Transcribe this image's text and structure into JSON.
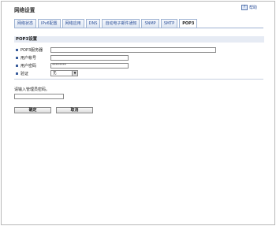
{
  "page": {
    "title": "网络设置"
  },
  "help": {
    "label": "帮助",
    "icon": "help-book-icon"
  },
  "tabs": [
    {
      "label": "网络状态",
      "active": false
    },
    {
      "label": "IPv6配置",
      "active": false
    },
    {
      "label": "网络应用",
      "active": false
    },
    {
      "label": "DNS",
      "active": false
    },
    {
      "label": "自动电子邮件通知",
      "active": false
    },
    {
      "label": "SNMP",
      "active": false
    },
    {
      "label": "SMTP",
      "active": false
    },
    {
      "label": "POP3",
      "active": true
    }
  ],
  "section": {
    "title": "POP3设置"
  },
  "form": {
    "server_label": "POP3服务器",
    "server_value": "",
    "account_label": "用户帐号",
    "account_value": "",
    "password_label": "用户密码",
    "password_value": "********",
    "auth_label": "验证",
    "auth_value": "无"
  },
  "admin": {
    "prompt": "请输入管理员密码。",
    "value": ""
  },
  "buttons": {
    "ok": "确定",
    "cancel": "取消"
  },
  "colors": {
    "accent": "#3a5d9c",
    "tab_border": "#9db2d2",
    "section_bg": "#e6ebf4"
  }
}
